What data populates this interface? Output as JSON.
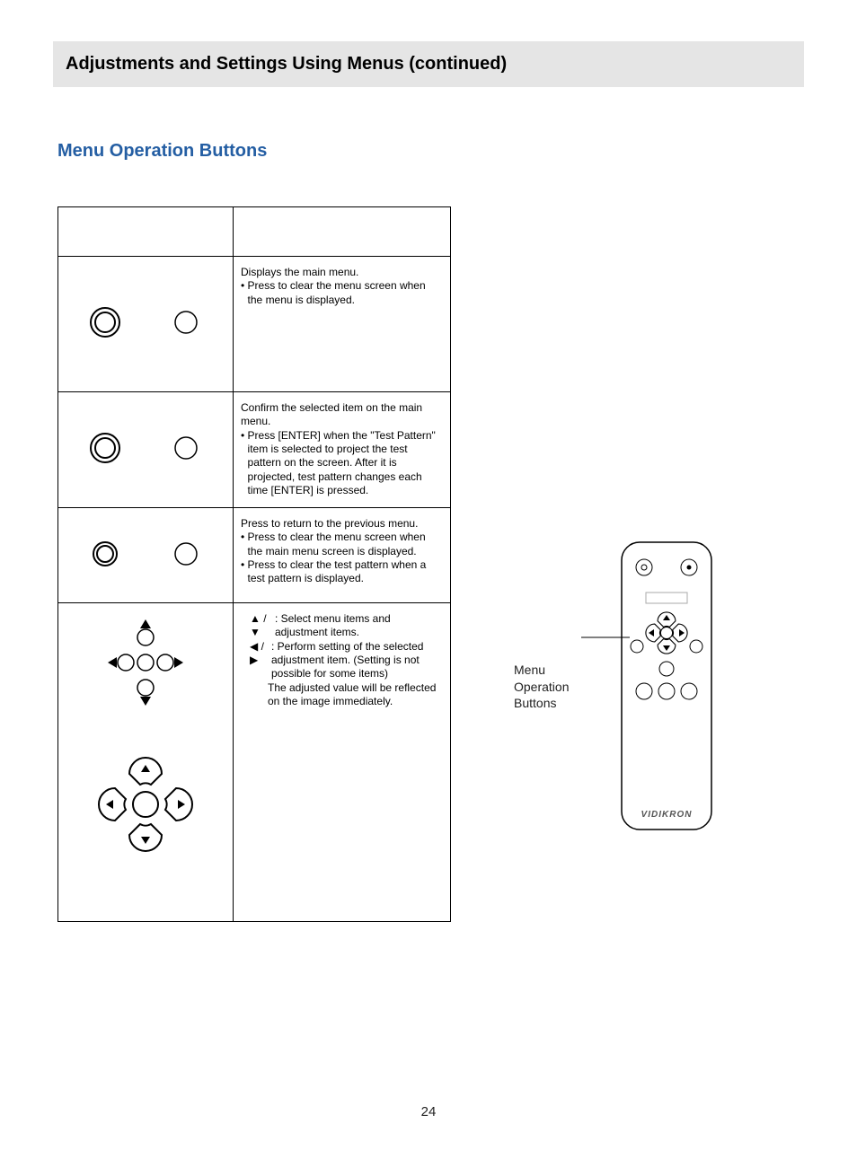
{
  "header": {
    "title": "Adjustments and Settings Using Menus (continued)"
  },
  "section": {
    "title": "Menu Operation Buttons"
  },
  "table": {
    "rows": [
      {
        "main": "Displays the main menu.",
        "bullets": [
          "Press to clear the menu screen when the menu is displayed."
        ]
      },
      {
        "main": "Confirm the selected item on the main menu.",
        "bullets": [
          "Press [ENTER] when the \"Test Pattern\" item is selected to project the test pattern on the screen. After it is projected, test pattern changes each time [ENTER] is pressed."
        ]
      },
      {
        "main": "Press to return to the previous menu.",
        "bullets": [
          "Press to clear the menu screen when the main menu screen is displayed.",
          "Press to clear the test pattern when a test pattern is displayed."
        ]
      },
      {
        "arrow1_label": "Select menu items and adjustment items.",
        "arrow2_label": "Perform setting of the selected adjustment item. (Setting is not possible for some items)",
        "arrow2_note": "The adjusted value will be reflected on the image immediately."
      }
    ]
  },
  "remote": {
    "label_l1": "Menu",
    "label_l2": "Operation",
    "label_l3": "Buttons",
    "brand": "VIDIKRON"
  },
  "page": "24"
}
